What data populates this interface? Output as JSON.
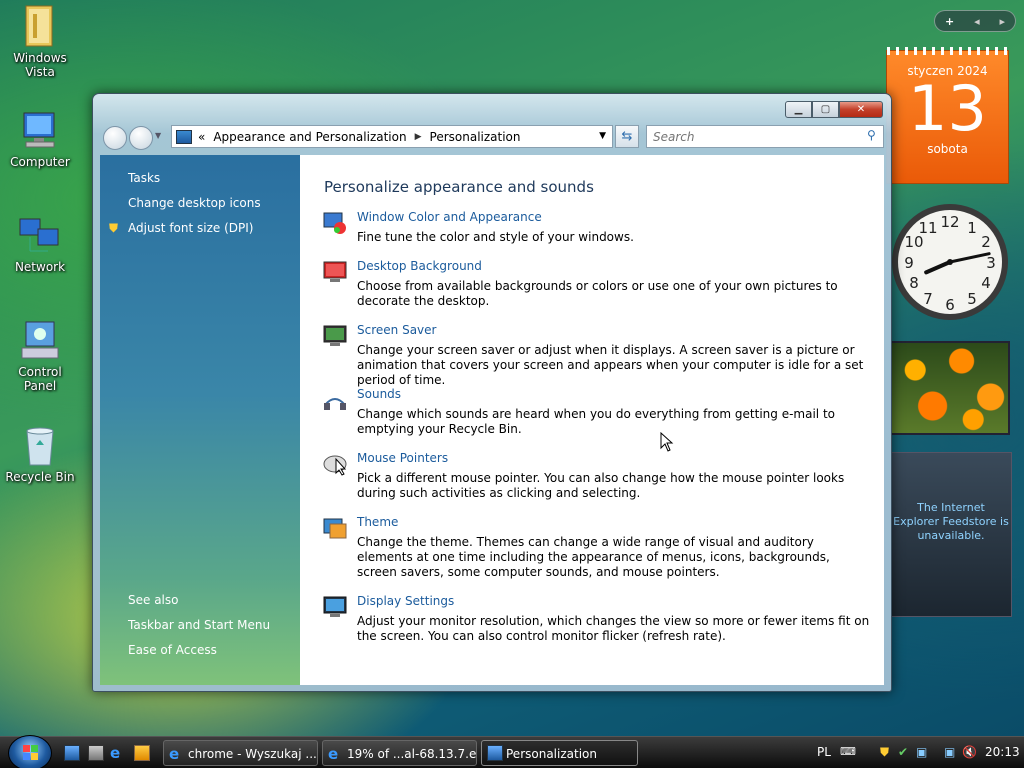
{
  "desktop": {
    "icons": [
      {
        "label": "Windows\nVista",
        "name": "windows-vista-folder"
      },
      {
        "label": "Computer",
        "name": "computer"
      },
      {
        "label": "Network",
        "name": "network"
      },
      {
        "label": "Control Panel",
        "name": "control-panel"
      },
      {
        "label": "Recycle Bin",
        "name": "recycle-bin"
      }
    ]
  },
  "window": {
    "address": {
      "overflow": "«",
      "crumb1": "Appearance and Personalization",
      "crumb2": "Personalization"
    },
    "search_placeholder": "Search",
    "left_pane": {
      "tasks_heading": "Tasks",
      "tasks": [
        "Change desktop icons",
        "Adjust font size (DPI)"
      ],
      "see_also_heading": "See also",
      "see_also": [
        "Taskbar and Start Menu",
        "Ease of Access"
      ]
    },
    "content": {
      "title": "Personalize appearance and sounds",
      "items": [
        {
          "title": "Window Color and Appearance",
          "desc": "Fine tune the color and style of your windows."
        },
        {
          "title": "Desktop Background",
          "desc": "Choose from available backgrounds or colors or use one of your own pictures to decorate the desktop."
        },
        {
          "title": "Screen Saver",
          "desc": "Change your screen saver or adjust when it displays. A screen saver is a picture or animation that covers your screen and appears when your computer is idle for a set period of time."
        },
        {
          "title": "Sounds",
          "desc": "Change which sounds are heard when you do everything from getting e-mail to emptying your Recycle Bin."
        },
        {
          "title": "Mouse Pointers",
          "desc": "Pick a different mouse pointer. You can also change how the mouse pointer looks during such activities as clicking and selecting."
        },
        {
          "title": "Theme",
          "desc": "Change the theme. Themes can change a wide range of visual and auditory elements at one time including the appearance of menus, icons, backgrounds, screen savers, some computer sounds, and mouse pointers."
        },
        {
          "title": "Display Settings",
          "desc": "Adjust your monitor resolution, which changes the view so more or fewer items fit on the screen. You can also control monitor flicker (refresh rate)."
        }
      ]
    }
  },
  "gadgets": {
    "calendar": {
      "month": "styczen 2024",
      "day": "13",
      "weekday": "sobota"
    },
    "clock": {
      "hour": 8,
      "minute": 13
    },
    "feeds_message": "The Internet Explorer Feedstore is unavailable.",
    "sidebar_controls": {
      "add": "+",
      "prev": "◂",
      "next": "▸"
    }
  },
  "taskbar": {
    "tasks": [
      {
        "label": "chrome - Wyszukaj ...",
        "active": false
      },
      {
        "label": "19% of ...al-68.13.7.e...",
        "active": false
      },
      {
        "label": "Personalization",
        "active": true
      }
    ],
    "language": "PL",
    "time": "20:13"
  }
}
